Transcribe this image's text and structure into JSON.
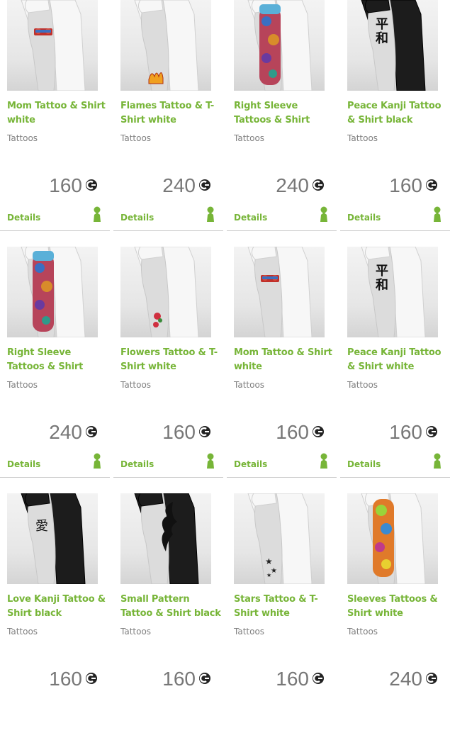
{
  "items": [
    {
      "title": "Mom Tattoo & Shirt white",
      "category": "Tattoos",
      "price": "160",
      "details": "Details",
      "shirt": "white",
      "tattoo": "mom"
    },
    {
      "title": "Flames Tattoo & T-Shirt white",
      "category": "Tattoos",
      "price": "240",
      "details": "Details",
      "shirt": "white",
      "tattoo": "flames"
    },
    {
      "title": "Right Sleeve Tattoos & Shirt",
      "category": "Tattoos",
      "price": "240",
      "details": "Details",
      "shirt": "white",
      "tattoo": "sleeve"
    },
    {
      "title": "Peace Kanji Tattoo & Shirt black",
      "category": "Tattoos",
      "price": "160",
      "details": "Details",
      "shirt": "black",
      "tattoo": "kanji"
    },
    {
      "title": "Right Sleeve Tattoos & Shirt",
      "category": "Tattoos",
      "price": "240",
      "details": "Details",
      "shirt": "white",
      "tattoo": "sleeve"
    },
    {
      "title": "Flowers Tattoo & T-Shirt white",
      "category": "Tattoos",
      "price": "160",
      "details": "Details",
      "shirt": "white",
      "tattoo": "flowers"
    },
    {
      "title": "Mom Tattoo & Shirt white",
      "category": "Tattoos",
      "price": "160",
      "details": "Details",
      "shirt": "white",
      "tattoo": "mom"
    },
    {
      "title": "Peace Kanji Tattoo & Shirt white",
      "category": "Tattoos",
      "price": "160",
      "details": "Details",
      "shirt": "white",
      "tattoo": "kanji"
    },
    {
      "title": "Love Kanji Tattoo & Shirt black",
      "category": "Tattoos",
      "price": "160",
      "details": "",
      "shirt": "black",
      "tattoo": "love"
    },
    {
      "title": "Small Pattern Tattoo & Shirt black",
      "category": "Tattoos",
      "price": "160",
      "details": "",
      "shirt": "black",
      "tattoo": "tribal"
    },
    {
      "title": "Stars Tattoo & T-Shirt white",
      "category": "Tattoos",
      "price": "160",
      "details": "",
      "shirt": "white",
      "tattoo": "stars"
    },
    {
      "title": "Sleeves Tattoos & Shirt white",
      "category": "Tattoos",
      "price": "240",
      "details": "",
      "shirt": "white",
      "tattoo": "sleeves"
    }
  ],
  "colors": {
    "accent": "#77b538",
    "price": "#777777",
    "divider": "#cccccc"
  },
  "icons": {
    "currency": "microsoft-points-icon",
    "avatar": "avatar-icon"
  }
}
